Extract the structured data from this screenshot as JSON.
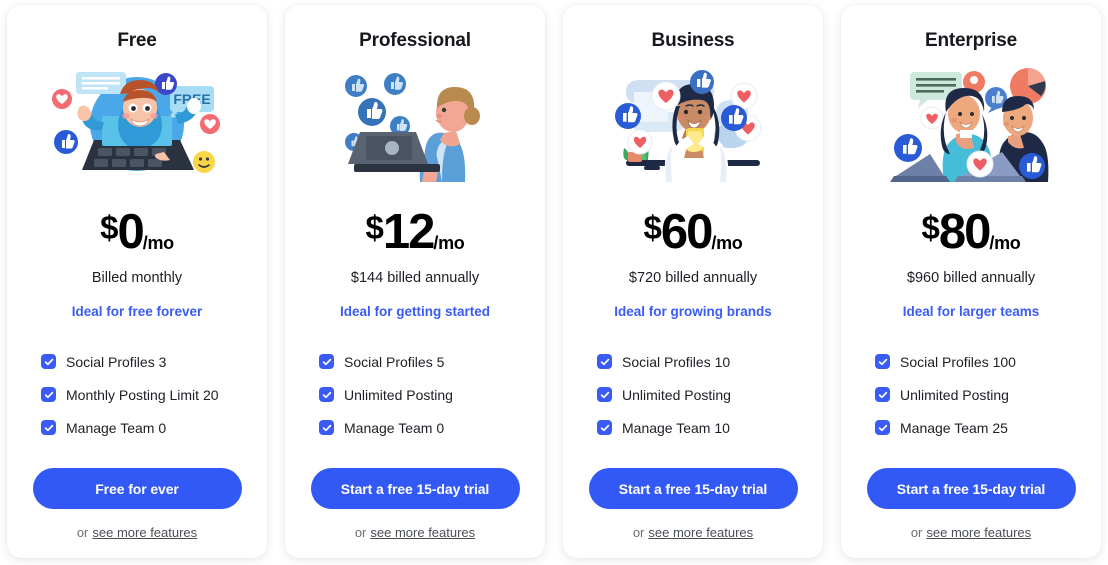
{
  "accent_color": "#3258f5",
  "link_color": "#3a5bf5",
  "text_color": "#1d1f24",
  "muted_color": "#6b6f76",
  "card_bg": "#ffffff",
  "page_bg": "#ffffff",
  "check_icon_name": "checkmark-icon",
  "plans": [
    {
      "name": "Free",
      "illustration": "man-popping-out-of-laptop-with-free-badge-illustration",
      "currency": "$",
      "amount": "0",
      "period": "/mo",
      "billing_note": "Billed monthly",
      "ideal_label": "Ideal for free forever",
      "features": [
        "Social Profiles 3",
        "Monthly Posting Limit 20",
        "Manage Team 0"
      ],
      "cta_label": "Free for ever",
      "more_prefix": "or",
      "more_label": "see more features"
    },
    {
      "name": "Professional",
      "illustration": "woman-at-laptop-with-thumbs-up-bubbles-illustration",
      "currency": "$",
      "amount": "12",
      "period": "/mo",
      "billing_note": "$144 billed annually",
      "ideal_label": "Ideal for getting started",
      "features": [
        "Social Profiles 5",
        "Unlimited Posting",
        "Manage Team 0"
      ],
      "cta_label": "Start a free 15-day trial",
      "more_prefix": "or",
      "more_label": "see more features"
    },
    {
      "name": "Business",
      "illustration": "woman-with-phone-and-social-reactions-illustration",
      "currency": "$",
      "amount": "60",
      "period": "/mo",
      "billing_note": "$720 billed annually",
      "ideal_label": "Ideal for growing brands",
      "features": [
        "Social Profiles 10",
        "Unlimited Posting",
        "Manage Team 10"
      ],
      "cta_label": "Start a free 15-day trial",
      "more_prefix": "or",
      "more_label": "see more features"
    },
    {
      "name": "Enterprise",
      "illustration": "two-people-with-laptops-and-analytics-illustration",
      "currency": "$",
      "amount": "80",
      "period": "/mo",
      "billing_note": "$960 billed annually",
      "ideal_label": "Ideal for larger teams",
      "features": [
        "Social Profiles 100",
        "Unlimited Posting",
        "Manage Team 25"
      ],
      "cta_label": "Start a free 15-day trial",
      "more_prefix": "or",
      "more_label": "see more features"
    }
  ]
}
